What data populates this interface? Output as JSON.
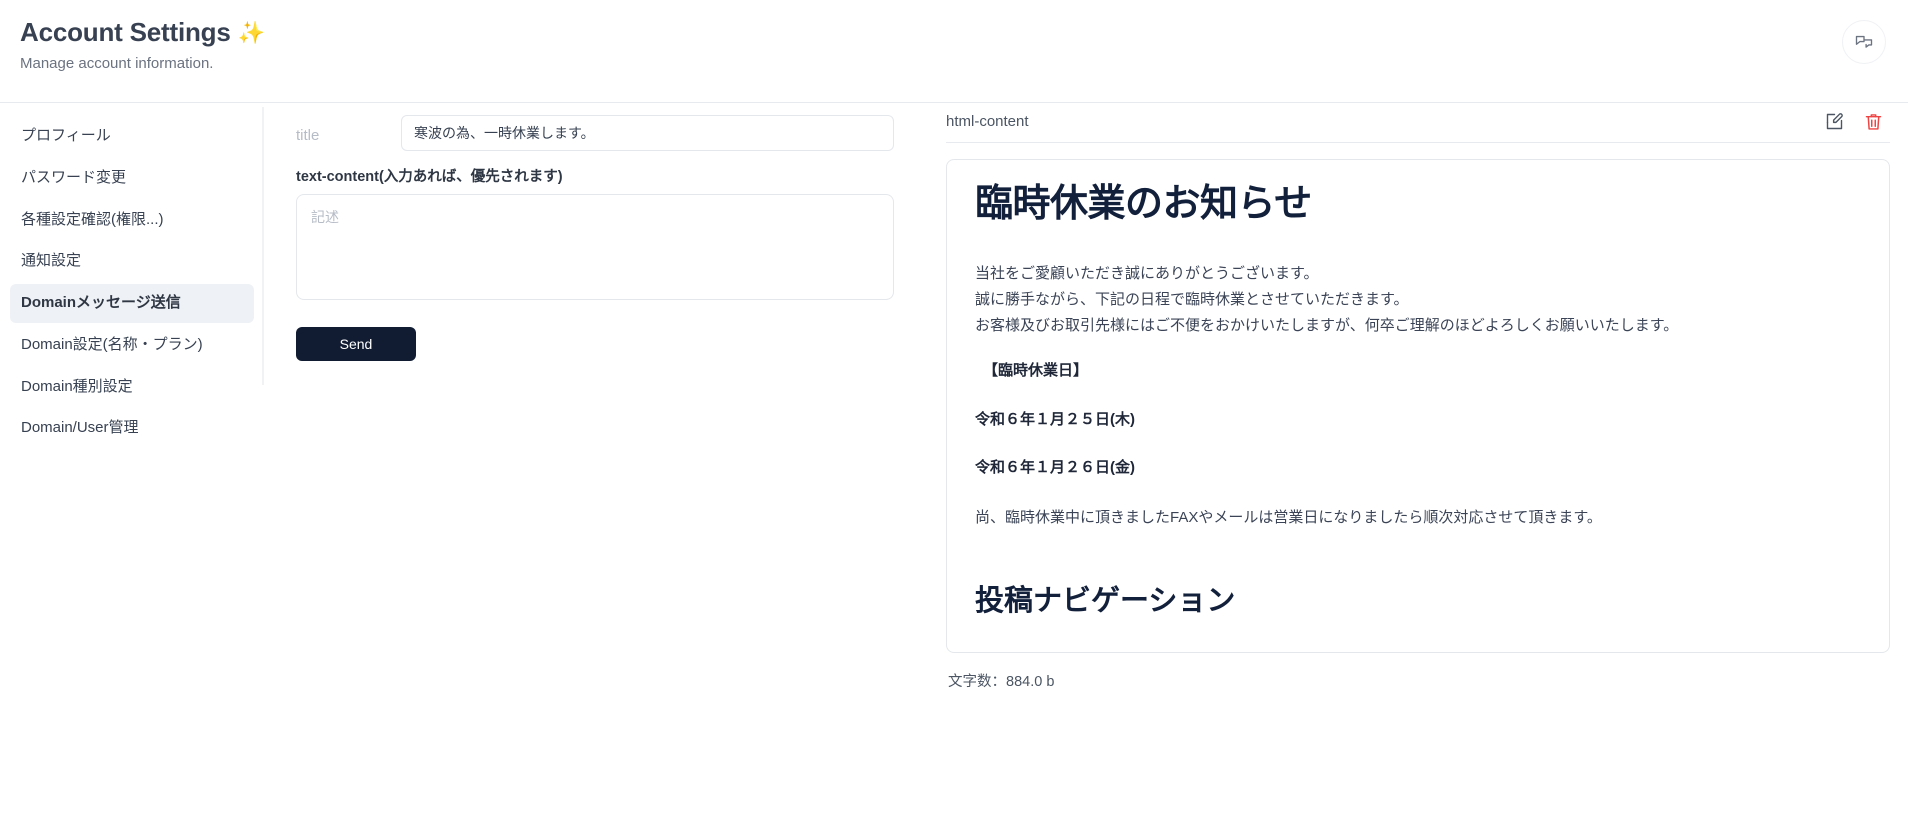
{
  "header": {
    "title": "Account Settings",
    "title_emoji": "✨",
    "subtitle": "Manage account information.",
    "action_icon": "chat-bubbles-icon"
  },
  "sidebar": {
    "items": [
      {
        "label": "プロフィール",
        "active": false
      },
      {
        "label": "パスワード変更",
        "active": false
      },
      {
        "label": "各種設定確認(権限...)",
        "active": false
      },
      {
        "label": "通知設定",
        "active": false
      },
      {
        "label": "Domainメッセージ送信",
        "active": true
      },
      {
        "label": "Domain設定(名称・プラン)",
        "active": false
      },
      {
        "label": "Domain種別設定",
        "active": false
      },
      {
        "label": "Domain/User管理",
        "active": false
      }
    ]
  },
  "form": {
    "title_label": "title",
    "title_value": "寒波の為、一時休業します。",
    "title_placeholder": "",
    "text_content_label": "text-content(入力あれば、優先されます)",
    "text_content_value": "",
    "text_content_placeholder": "記述",
    "send_label": "Send"
  },
  "preview": {
    "label": "html-content",
    "edit_icon": "edit-square-icon",
    "delete_icon": "trash-icon",
    "heading": "臨時休業のお知らせ",
    "paragraphs": [
      "当社をご愛顧いただき誠にありがとうございます。",
      "誠に勝手ながら、下記の日程で臨時休業とさせていただきます。",
      "お客様及びお取引先様にはご不便をおかけいたしますが、何卒ご理解のほどよろしくお願いいたします。"
    ],
    "notice_label": "【臨時休業日】",
    "date_1": "令和６年１月２５日(木)",
    "date_2": "令和６年１月２６日(金)",
    "closing": "尚、臨時休業中に頂きましたFAXやメールは営業日になりましたら順次対応させて頂きます。",
    "subheading": "投稿ナビゲーション",
    "char_count": "文字数：884.0 b"
  },
  "colors": {
    "accent_dark": "#111c32",
    "danger": "#ef4444",
    "sidebar_active_bg": "#eef1f5",
    "border": "#e4e7eb",
    "heading": "#13203b"
  }
}
